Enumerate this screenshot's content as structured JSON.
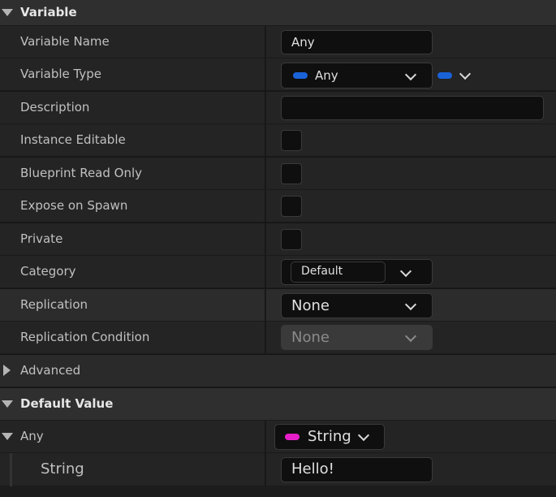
{
  "sections": {
    "variable": "Variable",
    "advanced": "Advanced",
    "default_value": "Default Value"
  },
  "rows": {
    "variable_name": {
      "label": "Variable Name",
      "value": "Any"
    },
    "variable_type": {
      "label": "Variable Type",
      "value": "Any",
      "pin_color": "#1a62d8"
    },
    "description": {
      "label": "Description",
      "value": ""
    },
    "instance_editable": {
      "label": "Instance Editable",
      "checked": false
    },
    "blueprint_read_only": {
      "label": "Blueprint Read Only",
      "checked": false
    },
    "expose_on_spawn": {
      "label": "Expose on Spawn",
      "checked": false
    },
    "private": {
      "label": "Private",
      "checked": false
    },
    "category": {
      "label": "Category",
      "value": "Default"
    },
    "replication": {
      "label": "Replication",
      "value": "None"
    },
    "replication_condition": {
      "label": "Replication Condition",
      "value": "None"
    }
  },
  "default_value": {
    "any": {
      "label": "Any",
      "type": "String",
      "pin_color": "#e61ec8"
    },
    "string": {
      "label": "String",
      "value": "Hello!"
    }
  }
}
